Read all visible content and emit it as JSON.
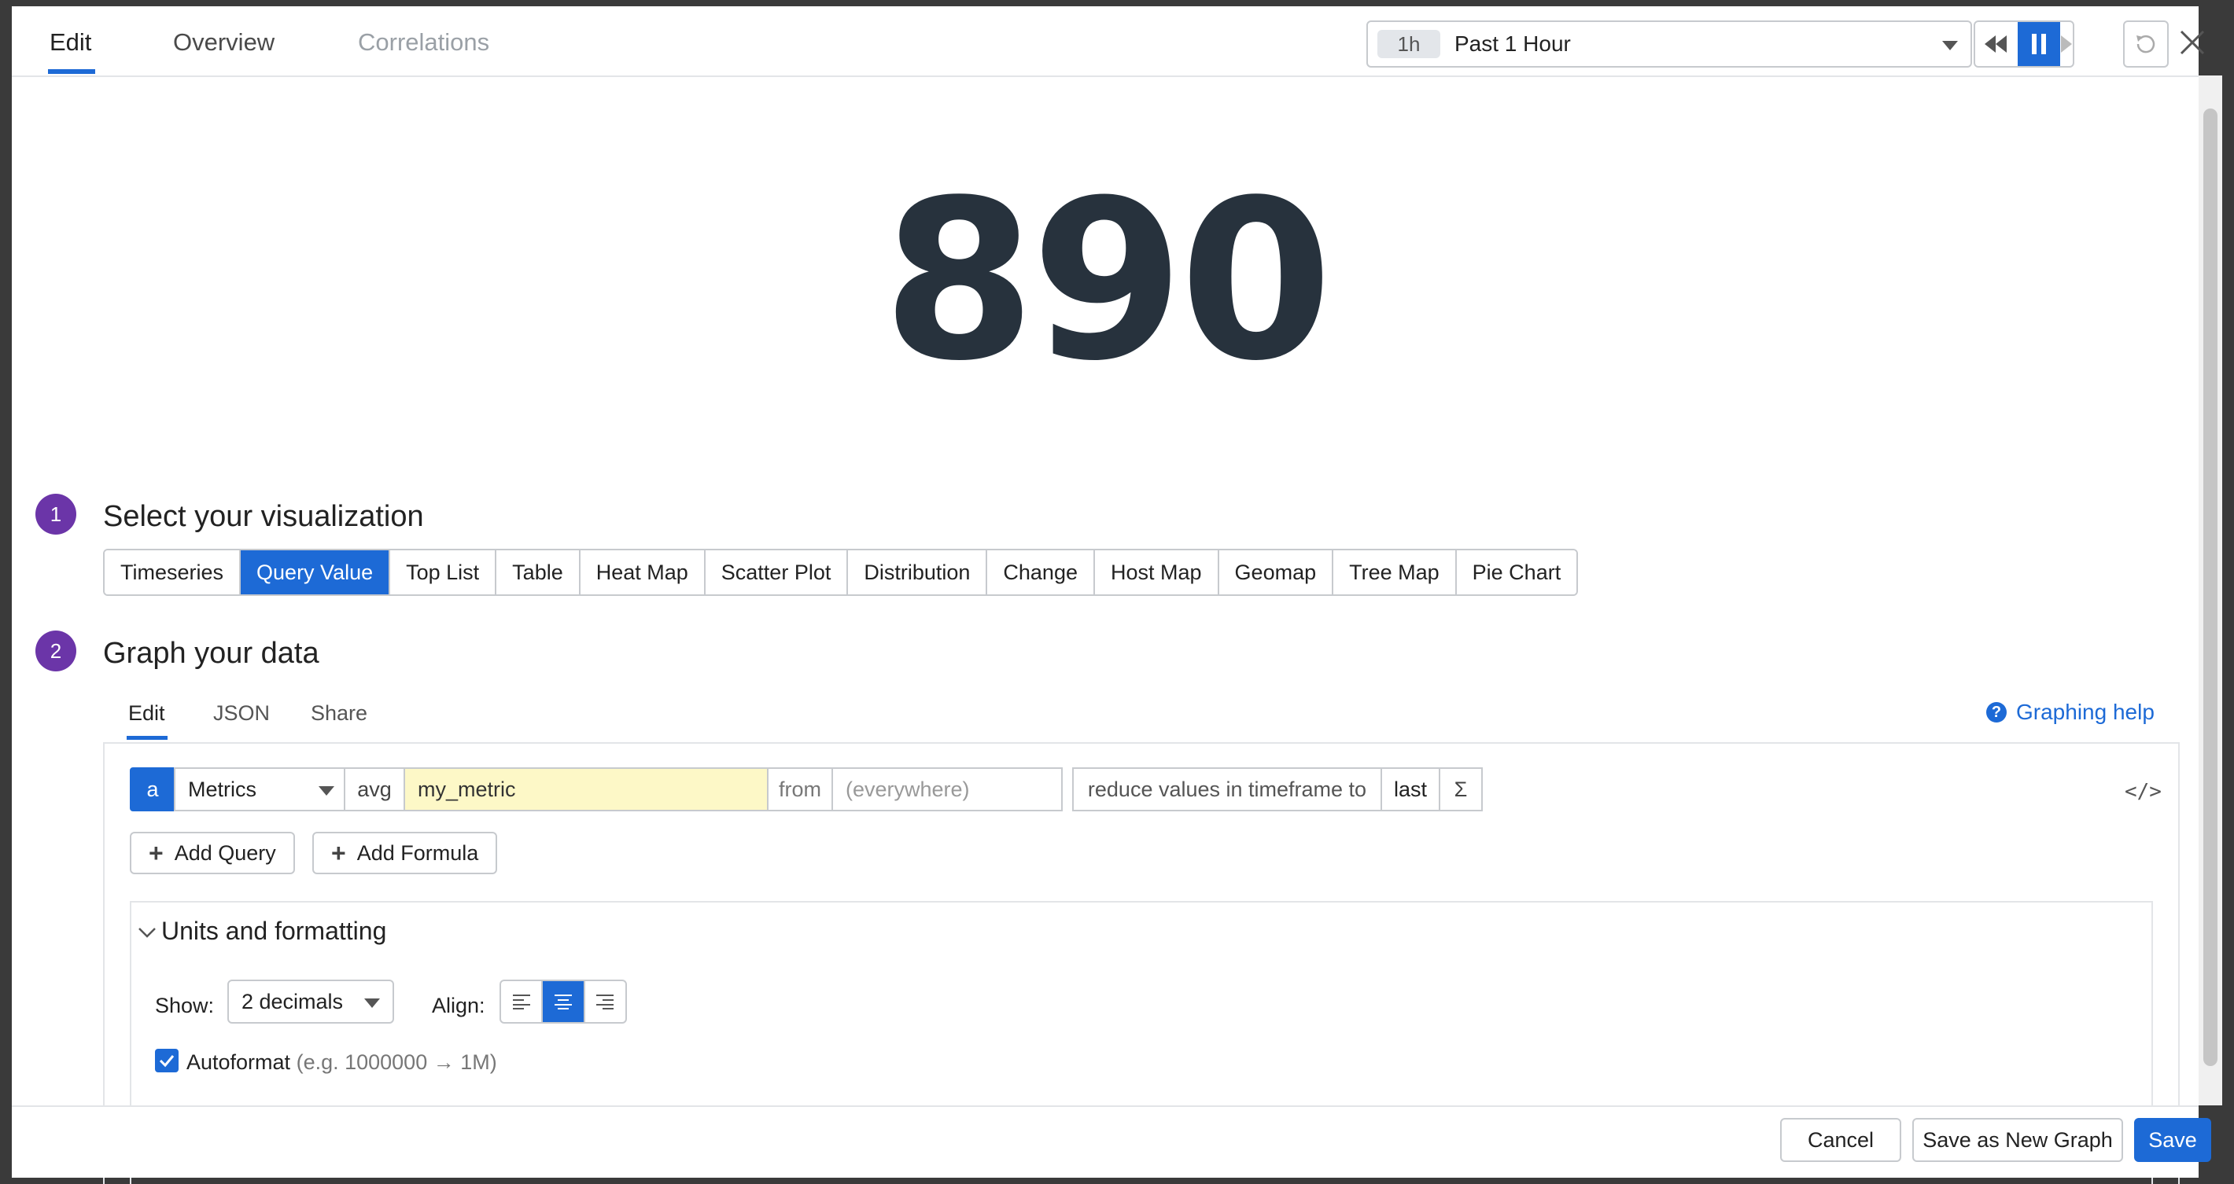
{
  "header": {
    "tabs": [
      {
        "label": "Edit"
      },
      {
        "label": "Overview"
      },
      {
        "label": "Correlations"
      }
    ],
    "timepicker": {
      "badge": "1h",
      "label": "Past 1 Hour"
    }
  },
  "value": {
    "display": "890"
  },
  "steps": {
    "visualization": {
      "number": "1",
      "title": "Select your visualization"
    },
    "data": {
      "number": "2",
      "title": "Graph your data"
    }
  },
  "viz_types": [
    "Timeseries",
    "Query Value",
    "Top List",
    "Table",
    "Heat Map",
    "Scatter Plot",
    "Distribution",
    "Change",
    "Host Map",
    "Geomap",
    "Tree Map",
    "Pie Chart"
  ],
  "viz_selected": "Query Value",
  "editor": {
    "tabs": [
      {
        "label": "Edit"
      },
      {
        "label": "JSON"
      },
      {
        "label": "Share"
      }
    ],
    "help": "Graphing help",
    "query": {
      "letter": "a",
      "source": "Metrics",
      "aggregation": "avg",
      "metric": "my_metric",
      "from_label": "from",
      "scope": "(everywhere)",
      "reduce_label": "reduce values in timeframe to",
      "reducer": "last",
      "sigma": "Σ"
    },
    "add_query": "Add Query",
    "add_formula": "Add Formula"
  },
  "units": {
    "title": "Units and formatting",
    "show_label": "Show:",
    "show_value": "2 decimals",
    "align_label": "Align:",
    "align_selected": "center",
    "autoformat_label": "Autoformat",
    "autoformat_hint": "(e.g. 1000000 → 1M)",
    "autoformat_checked": true
  },
  "footer": {
    "cancel": "Cancel",
    "save_new": "Save as New Graph",
    "save": "Save"
  },
  "colors": {
    "accent": "#1d6ad6",
    "step": "#6b35a8",
    "highlight": "#fdf8c7"
  }
}
